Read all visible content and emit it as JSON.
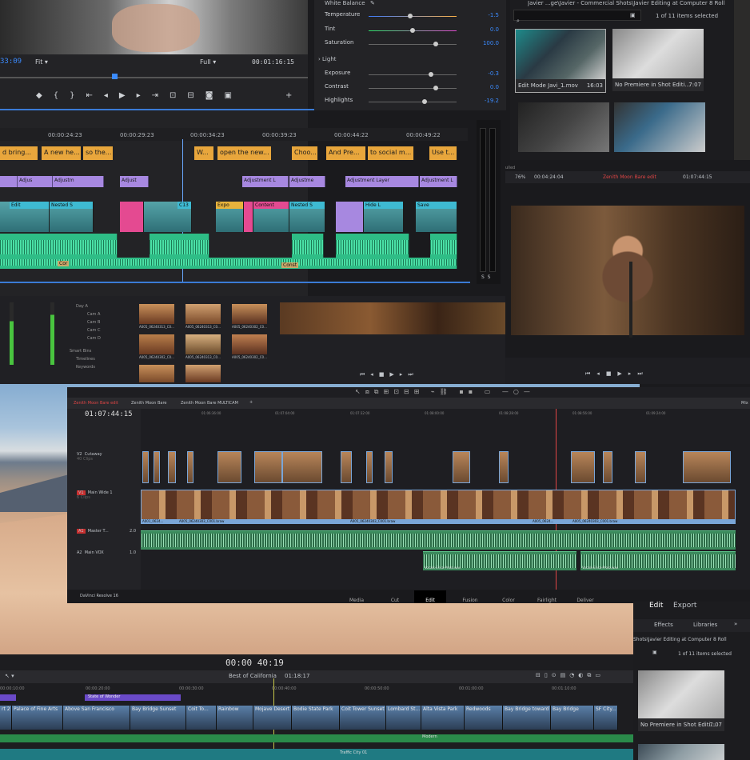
{
  "premiere": {
    "timecode_left": "33:09",
    "fit": "Fit",
    "full": "Full",
    "timecode_right": "00:01:16:15",
    "ruler": [
      "00:00:24:23",
      "00:00:29:23",
      "00:00:34:23",
      "00:00:39:23",
      "00:00:44:22",
      "00:00:49:22"
    ],
    "captions": [
      "d bring...",
      "A new he...",
      "so the...",
      "W...",
      "open the new...",
      "Choo...",
      "And Pre...",
      "to social m...",
      "Use t..."
    ],
    "adjust": [
      "Adjus",
      "Adjustm",
      "Adjust",
      "Adjustment L",
      "Adjustme",
      "Adjustment Layer",
      "Adjustment L"
    ],
    "video_labels": [
      "Edit",
      "Nested S",
      "C13",
      "Expo",
      "Content",
      "Nested S",
      "Hide L",
      "Save"
    ],
    "audio_label": "Cor",
    "audio_label2": "Const"
  },
  "lumetri": {
    "white_balance": "White Balance",
    "rows": [
      {
        "label": "Temperature",
        "value": "-1.5"
      },
      {
        "label": "Tint",
        "value": "0.0"
      },
      {
        "label": "Saturation",
        "value": "100.0"
      }
    ],
    "light": "Light",
    "light_rows": [
      {
        "label": "Exposure",
        "value": "-0.3"
      },
      {
        "label": "Contrast",
        "value": "0.0"
      },
      {
        "label": "Highlights",
        "value": "-19.2"
      }
    ]
  },
  "project": {
    "path": "Javier ...ge\\Javier - Commercial Shots\\Javier Editing at Computer 8 Roll",
    "count": "1 of 11 items selected",
    "thumbs": [
      {
        "name": "Edit Mode Javi_1.mov",
        "dur": "16:03"
      },
      {
        "name": "No Premiere in Shot Editi...",
        "dur": "7:07"
      }
    ]
  },
  "player2": {
    "zoom": "76%",
    "tc1": "00:04:24:04",
    "title": "Zenith Moon Bare edit",
    "tc2": "01:07:44:15",
    "label": "ulled"
  },
  "bins": {
    "items": [
      "Day A",
      "Cam A",
      "Cam B",
      "Cam C",
      "Cam D"
    ],
    "smart": "Smart Bins",
    "smart_items": [
      "Timelines",
      "Keywords"
    ],
    "clips": [
      "A005_06240313_C0...",
      "A005_06240313_C0...",
      "A005_06240302_C0...",
      "A005_06240302_C0...",
      "A005_06240313_C0...",
      "A005_06240302_C0...",
      "A005_06240401_C0...",
      "A005_06240401_C0...",
      "A005_06240401_C0..."
    ]
  },
  "resolve": {
    "tabs": [
      "Zenith Moon Bare edit",
      "Zenith Moon Bare",
      "Zenith Moon Bare MULTICAM"
    ],
    "timecode": "01:07:44:15",
    "ruler": [
      "01:06:36:00",
      "01:07:04:00",
      "01:07:32:00",
      "01:08:00:00",
      "01:08:28:00",
      "01:08:56:00",
      "01:09:24:00"
    ],
    "tracks": [
      {
        "id": "V2",
        "name": "Cutaway",
        "sub": "40 Clips"
      },
      {
        "id": "V1",
        "name": "Main Wide 1",
        "sub": "6 Clips"
      },
      {
        "id": "A1",
        "name": "Master T...",
        "level": "2.0"
      },
      {
        "id": "A2",
        "name": "Main VOX",
        "level": "1.0"
      }
    ],
    "clip_labels": [
      "A005_06240303_C001.braw",
      "A005_06240303_C001.braw",
      "A005_06240303_C001.braw",
      "Vocals-Erica-Proto.wav",
      "Vocals-Erica-Proto.wav",
      "A001_0624...",
      "A005_0624..."
    ],
    "brand": "DaVinci Resolve 16",
    "pages": [
      "Media",
      "Cut",
      "Edit",
      "Fusion",
      "Color",
      "Fairlight",
      "Deliver"
    ],
    "active_page": "Edit",
    "right_label": "Mix"
  },
  "fcp": {
    "timecode": "00:00 40:19",
    "project": "Best of California",
    "duration": "01:18:17",
    "ruler": [
      "00:00:10:00",
      "00:00:20:00",
      "00:00:30:00",
      "00:00:40:00",
      "00:00:50:00",
      "00:01:00:00",
      "00:01:10:00"
    ],
    "purple": "State of Wonder",
    "clips": [
      "rt 2",
      "Palace of Fine Arts",
      "Above San Francisco",
      "Bay Bridge Sunset",
      "Coit To...",
      "Rainbow",
      "Mojave Desert",
      "Bodie State Park",
      "Coit Tower Sunset",
      "Lombard St...",
      "Alta Vista Park",
      "Redwoods",
      "Bay Bridge toward SF",
      "Bay Bridge",
      "SF City..."
    ],
    "green": "Modern",
    "teal": "Traffic City 01"
  },
  "panel_br": {
    "tabs": [
      "Edit",
      "Export"
    ],
    "sub_tabs": [
      "Effects",
      "Libraries"
    ],
    "path": "Shots\\Javier Editing at Computer 8 Roll",
    "count": "1 of 11 items selected",
    "thumb": {
      "name": "No Premiere in Shot Editi...",
      "dur": "7:07"
    }
  }
}
